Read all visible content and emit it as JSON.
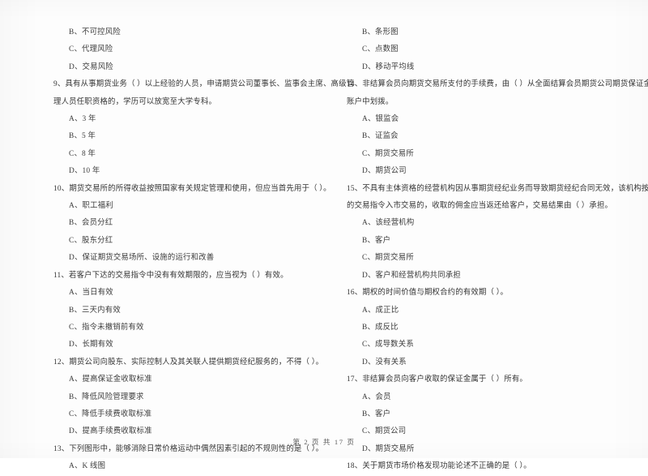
{
  "document": {
    "type": "exam-paper",
    "language": "zh-CN",
    "footer": "第 2 页 共 17 页"
  },
  "left_column": {
    "blocks": [
      {
        "kind": "option",
        "text": "B、不可控风险"
      },
      {
        "kind": "option",
        "text": "C、代理风险"
      },
      {
        "kind": "option",
        "text": "D、交易风险"
      },
      {
        "kind": "question",
        "line1": "9、具有从事期货业务（      ）以上经验的人员，申请期货公司董事长、监事会主席、高级管",
        "line2": "理人员任职资格的，学历可以放宽至大学专科。"
      },
      {
        "kind": "option",
        "text": "A、3 年"
      },
      {
        "kind": "option",
        "text": "B、5 年"
      },
      {
        "kind": "option",
        "text": "C、8 年"
      },
      {
        "kind": "option",
        "text": "D、10 年"
      },
      {
        "kind": "question",
        "line1": "10、期货交易所的所得收益按照国家有关规定管理和使用，但应当首先用于（      ）。"
      },
      {
        "kind": "option",
        "text": "A、职工福利"
      },
      {
        "kind": "option",
        "text": "B、会员分红"
      },
      {
        "kind": "option",
        "text": "C、股东分红"
      },
      {
        "kind": "option",
        "text": "D、保证期货交易场所、设施的运行和改善"
      },
      {
        "kind": "question",
        "line1": "11、若客户下达的交易指令中没有有效期限的，应当视为（      ）有效。"
      },
      {
        "kind": "option",
        "text": "A、当日有效"
      },
      {
        "kind": "option",
        "text": "B、三天内有效"
      },
      {
        "kind": "option",
        "text": "C、指令未撤销前有效"
      },
      {
        "kind": "option",
        "text": "D、长期有效"
      },
      {
        "kind": "question",
        "line1": "12、期货公司向股东、实际控制人及其关联人提供期货经纪服务的，不得（      ）。"
      },
      {
        "kind": "option",
        "text": "A、提高保证金收取标准"
      },
      {
        "kind": "option",
        "text": "B、降低风险管理要求"
      },
      {
        "kind": "option",
        "text": "C、降低手续费收取标准"
      },
      {
        "kind": "option",
        "text": "D、提高手续费收取标准"
      },
      {
        "kind": "question",
        "line1": "13、下列图形中，能够消除日常价格运动中偶然因素引起的不规则性的是（      ）。"
      },
      {
        "kind": "option",
        "text": "A、K 线图"
      }
    ]
  },
  "right_column": {
    "blocks": [
      {
        "kind": "option",
        "text": "B、条形图"
      },
      {
        "kind": "option",
        "text": "C、点数图"
      },
      {
        "kind": "option",
        "text": "D、移动平均线"
      },
      {
        "kind": "question",
        "line1": "14、非结算会员向期货交易所支付的手续费，由（      ）从全面结算会员期货公司期货保证金",
        "line2": "账户中划拨。"
      },
      {
        "kind": "option",
        "text": "A、银监会"
      },
      {
        "kind": "option",
        "text": "B、证监会"
      },
      {
        "kind": "option",
        "text": "C、期货交易所"
      },
      {
        "kind": "option",
        "text": "D、期货公司"
      },
      {
        "kind": "question",
        "line1": "15、不具有主体资格的经营机构因从事期货经纪业务而导致期货经纪合同无效，该机构按客户",
        "line2": "的交易指令入市交易的，收取的佣金应当返还给客户，交易结果由（      ）承担。"
      },
      {
        "kind": "option",
        "text": "A、该经营机构"
      },
      {
        "kind": "option",
        "text": "B、客户"
      },
      {
        "kind": "option",
        "text": "C、期货交易所"
      },
      {
        "kind": "option",
        "text": "D、客户和经营机构共同承担"
      },
      {
        "kind": "question",
        "line1": "16、期权的时间价值与期权合约的有效期（      ）。"
      },
      {
        "kind": "option",
        "text": "A、成正比"
      },
      {
        "kind": "option",
        "text": "B、成反比"
      },
      {
        "kind": "option",
        "text": "C、成导数关系"
      },
      {
        "kind": "option",
        "text": "D、没有关系"
      },
      {
        "kind": "question",
        "line1": "17、非结算会员向客户收取的保证金属于（      ）所有。"
      },
      {
        "kind": "option",
        "text": "A、会员"
      },
      {
        "kind": "option",
        "text": "B、客户"
      },
      {
        "kind": "option",
        "text": "C、期货公司"
      },
      {
        "kind": "option",
        "text": "D、期货交易所"
      },
      {
        "kind": "question",
        "line1": "18、关于期货市场价格发现功能论述不正确的是（      ）。"
      }
    ]
  }
}
